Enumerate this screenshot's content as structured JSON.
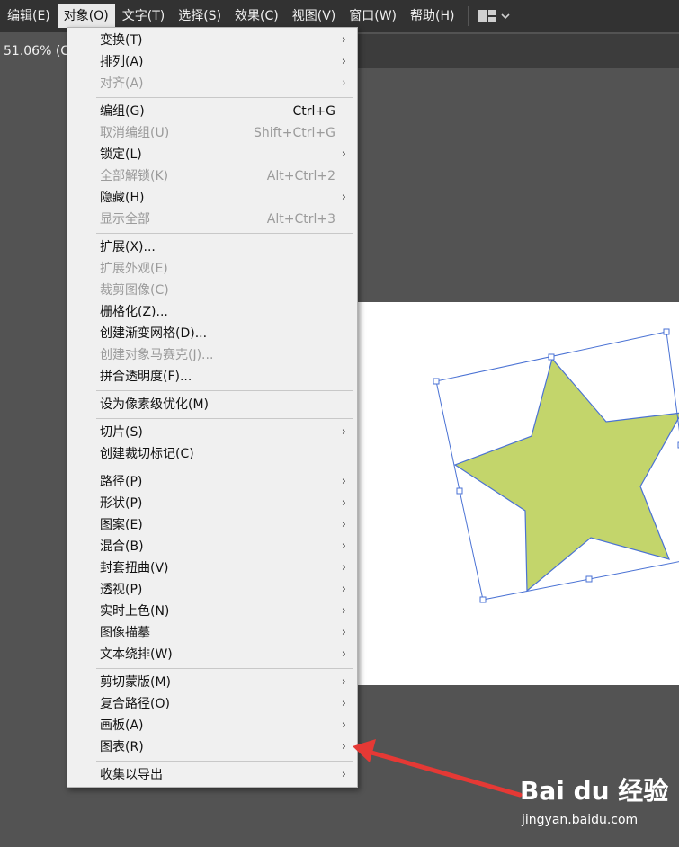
{
  "menubar": {
    "items": [
      {
        "label": "编辑(E)",
        "active": false
      },
      {
        "label": "对象(O)",
        "active": true
      },
      {
        "label": "文字(T)",
        "active": false
      },
      {
        "label": "选择(S)",
        "active": false
      },
      {
        "label": "效果(C)",
        "active": false
      },
      {
        "label": "视图(V)",
        "active": false
      },
      {
        "label": "窗口(W)",
        "active": false
      },
      {
        "label": "帮助(H)",
        "active": false
      }
    ],
    "workspace_icon": "workspace-layout-icon"
  },
  "document_tab": {
    "label": "51.06% (C"
  },
  "dropdown": {
    "groups": [
      [
        {
          "label": "变换(T)",
          "shortcut": "",
          "submenu": true,
          "disabled": false
        },
        {
          "label": "排列(A)",
          "shortcut": "",
          "submenu": true,
          "disabled": false
        },
        {
          "label": "对齐(A)",
          "shortcut": "",
          "submenu": true,
          "disabled": true
        }
      ],
      [
        {
          "label": "编组(G)",
          "shortcut": "Ctrl+G",
          "submenu": false,
          "disabled": false
        },
        {
          "label": "取消编组(U)",
          "shortcut": "Shift+Ctrl+G",
          "submenu": false,
          "disabled": true
        },
        {
          "label": "锁定(L)",
          "shortcut": "",
          "submenu": true,
          "disabled": false
        },
        {
          "label": "全部解锁(K)",
          "shortcut": "Alt+Ctrl+2",
          "submenu": false,
          "disabled": true
        },
        {
          "label": "隐藏(H)",
          "shortcut": "",
          "submenu": true,
          "disabled": false
        },
        {
          "label": "显示全部",
          "shortcut": "Alt+Ctrl+3",
          "submenu": false,
          "disabled": true
        }
      ],
      [
        {
          "label": "扩展(X)...",
          "shortcut": "",
          "submenu": false,
          "disabled": false
        },
        {
          "label": "扩展外观(E)",
          "shortcut": "",
          "submenu": false,
          "disabled": true
        },
        {
          "label": "裁剪图像(C)",
          "shortcut": "",
          "submenu": false,
          "disabled": true
        },
        {
          "label": "栅格化(Z)...",
          "shortcut": "",
          "submenu": false,
          "disabled": false
        },
        {
          "label": "创建渐变网格(D)...",
          "shortcut": "",
          "submenu": false,
          "disabled": false
        },
        {
          "label": "创建对象马赛克(J)...",
          "shortcut": "",
          "submenu": false,
          "disabled": true
        },
        {
          "label": "拼合透明度(F)...",
          "shortcut": "",
          "submenu": false,
          "disabled": false
        }
      ],
      [
        {
          "label": "设为像素级优化(M)",
          "shortcut": "",
          "submenu": false,
          "disabled": false
        }
      ],
      [
        {
          "label": "切片(S)",
          "shortcut": "",
          "submenu": true,
          "disabled": false
        },
        {
          "label": "创建裁切标记(C)",
          "shortcut": "",
          "submenu": false,
          "disabled": false
        }
      ],
      [
        {
          "label": "路径(P)",
          "shortcut": "",
          "submenu": true,
          "disabled": false
        },
        {
          "label": "形状(P)",
          "shortcut": "",
          "submenu": true,
          "disabled": false
        },
        {
          "label": "图案(E)",
          "shortcut": "",
          "submenu": true,
          "disabled": false
        },
        {
          "label": "混合(B)",
          "shortcut": "",
          "submenu": true,
          "disabled": false
        },
        {
          "label": "封套扭曲(V)",
          "shortcut": "",
          "submenu": true,
          "disabled": false
        },
        {
          "label": "透视(P)",
          "shortcut": "",
          "submenu": true,
          "disabled": false
        },
        {
          "label": "实时上色(N)",
          "shortcut": "",
          "submenu": true,
          "disabled": false
        },
        {
          "label": "图像描摹",
          "shortcut": "",
          "submenu": true,
          "disabled": false
        },
        {
          "label": "文本绕排(W)",
          "shortcut": "",
          "submenu": true,
          "disabled": false
        }
      ],
      [
        {
          "label": "剪切蒙版(M)",
          "shortcut": "",
          "submenu": true,
          "disabled": false
        },
        {
          "label": "复合路径(O)",
          "shortcut": "",
          "submenu": true,
          "disabled": false
        },
        {
          "label": "画板(A)",
          "shortcut": "",
          "submenu": true,
          "disabled": false
        },
        {
          "label": "图表(R)",
          "shortcut": "",
          "submenu": true,
          "disabled": false
        }
      ],
      [
        {
          "label": "收集以导出",
          "shortcut": "",
          "submenu": true,
          "disabled": false
        }
      ]
    ]
  },
  "colors": {
    "star_fill": "#c3d56b",
    "selection_stroke": "#4a72d4",
    "annotation_arrow": "#e53935"
  },
  "watermark": {
    "brand": "Bai du 经验",
    "url": "jingyan.baidu.com"
  }
}
